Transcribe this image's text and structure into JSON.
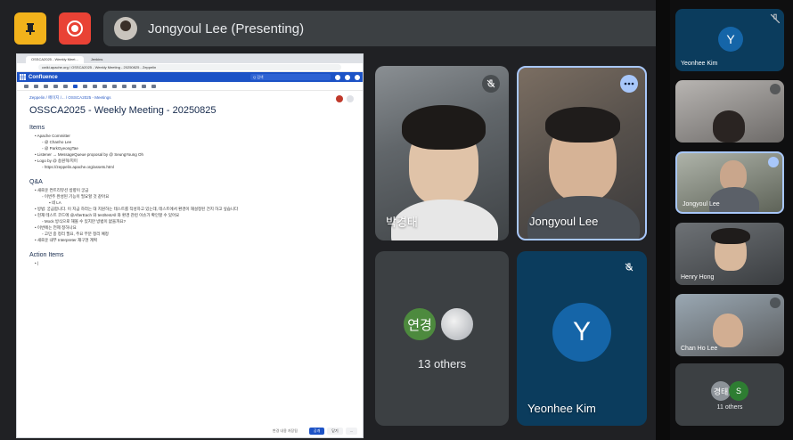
{
  "presenter": {
    "name": "Jongyoul Lee (Presenting)"
  },
  "shared_screen": {
    "browser_tabs": [
      "OSSCA2025 - Weekly Meet...",
      "Jenkins"
    ],
    "url": "cwiki.apache.org / OSSCA2025 - Weekly Meeting - 20250825 - Zeppelin",
    "app_name": "Confluence",
    "search_placeholder": "Q 검색",
    "breadcrumb": "Zeppelin / 페이지 /... / OSSCA2025 - Meetings",
    "page_title": "OSSCA2025 - Weekly Meeting - 20250825",
    "items_heading": "Items",
    "items": [
      {
        "level": 1,
        "text": "Apache Committer"
      },
      {
        "level": 2,
        "text": "@ Chanho Lee"
      },
      {
        "level": 2,
        "text": "@ ParkGyeongTae"
      },
      {
        "level": 1,
        "text": "Listener → MessageQueue proposal by @ SeungYoung Oh"
      },
      {
        "level": 1,
        "text": "Logo by @ 송원혁/지미"
      },
      {
        "level": 2,
        "text": "https://zeppelin.apache.org/assets.html"
      }
    ],
    "qa_heading": "Q&A",
    "qa": [
      {
        "level": 1,
        "text": "새로운 컨트리뷰션 방향이 궁금"
      },
      {
        "level": 2,
        "text": "이번주 완성된 기능이 필요할 것 같아요"
      },
      {
        "level": 3,
        "text": "네 LA"
      },
      {
        "level": 1,
        "text": "방법: 궁금합니다. 이 지금 하라는 대 지원하는 테스트를 작성하고 있는데, 테스트에서 환경이 재설정된 건지 하고 싶습니다"
      },
      {
        "level": 1,
        "text": "현재 테스트 코드에 @AfterEach 와 test/testAll 와 환경 관련 이슈가 확인할 수 있어요"
      },
      {
        "level": 2,
        "text": "Mock 방식으로 해볼 수 있지만 방법이 없을까요?"
      },
      {
        "level": 1,
        "text": "이번에는 언제 정하나요"
      },
      {
        "level": 2,
        "text": "고민 중 정리 필요, 주요 부분 정리 예정"
      },
      {
        "level": 1,
        "text": "새로운 내부 Interpreter 재구현 계획"
      }
    ],
    "action_heading": "Action Items",
    "footer_status": "변경 내용 저장됨",
    "footer_buttons": [
      "공개",
      "닫기",
      "..."
    ]
  },
  "tiles": {
    "tile1_name": "박경태",
    "tile2_name": "Jongyoul Lee",
    "others_avatar_initials": "연경",
    "others_label": "13 others",
    "yeonhee_initial": "Y",
    "yeonhee_name": "Yeonhee Kim"
  },
  "sidebar": {
    "tiles": [
      {
        "name": "Yeonhee Kim",
        "initial": "Y"
      },
      {
        "name": ""
      },
      {
        "name": "Jongyoul Lee"
      },
      {
        "name": "Henry Hong"
      },
      {
        "name": "Chan Ho Lee"
      }
    ],
    "others_initials": [
      "경태",
      "S"
    ],
    "others_label": "11 others"
  },
  "colors": {
    "accent": "#a8c7fa",
    "stop_button": "#e94235",
    "hand_button": "#f2b21b",
    "confluence_blue": "#1d53c6"
  }
}
